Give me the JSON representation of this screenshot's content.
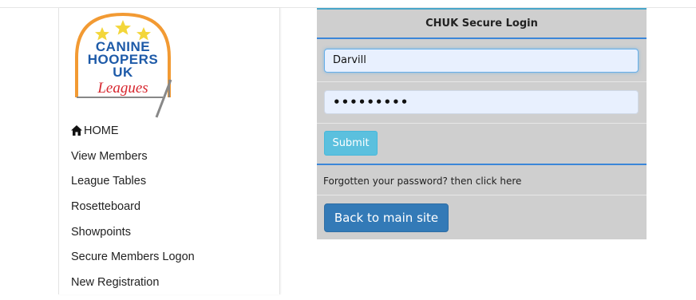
{
  "logo": {
    "line1": "CANINE",
    "line2": "HOOPERS",
    "line3": "UK",
    "line4": "Leagues",
    "stars": 3,
    "colors": {
      "arch": "#f29a33",
      "star": "#f3d63a",
      "blue_text": "#1d5aa8",
      "red_text": "#d7262e",
      "frame": "#888888"
    }
  },
  "sidebar": {
    "items": [
      {
        "label": "HOME",
        "icon": "home-icon"
      },
      {
        "label": "View Members"
      },
      {
        "label": "League Tables"
      },
      {
        "label": "Rosetteboard"
      },
      {
        "label": "Showpoints"
      },
      {
        "label": "Secure Members Logon"
      },
      {
        "label": "New Registration"
      }
    ]
  },
  "login": {
    "title": "CHUK Secure Login",
    "username_value": "Darvill",
    "password_value": "•••••••••",
    "submit_label": "Submit",
    "forgot_text": "Forgotten your password? then click here",
    "back_label": "Back to main site"
  },
  "colors": {
    "panel_bg": "#cfcfcf",
    "accent_blue": "#3b86d8",
    "submit_btn": "#5bc0de",
    "back_btn": "#337ab7"
  }
}
